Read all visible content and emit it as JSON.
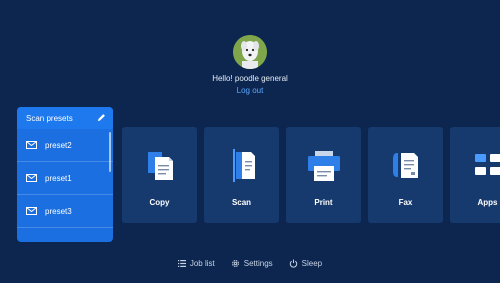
{
  "user": {
    "greeting": "Hello! poodle general",
    "logout_label": "Log out"
  },
  "presets": {
    "title": "Scan presets",
    "items": [
      {
        "label": "preset2"
      },
      {
        "label": "preset1"
      },
      {
        "label": "preset3"
      }
    ]
  },
  "tiles": [
    {
      "label": "Copy",
      "icon": "copy-icon"
    },
    {
      "label": "Scan",
      "icon": "scan-icon"
    },
    {
      "label": "Print",
      "icon": "print-icon"
    },
    {
      "label": "Fax",
      "icon": "fax-icon"
    },
    {
      "label": "Apps",
      "icon": "apps-icon"
    }
  ],
  "footer": {
    "job_list": "Job list",
    "settings": "Settings",
    "sleep": "Sleep"
  },
  "colors": {
    "background": "#0c2650",
    "tile": "#173a6e",
    "accent": "#1b6fe0",
    "link": "#5aa8ff"
  }
}
